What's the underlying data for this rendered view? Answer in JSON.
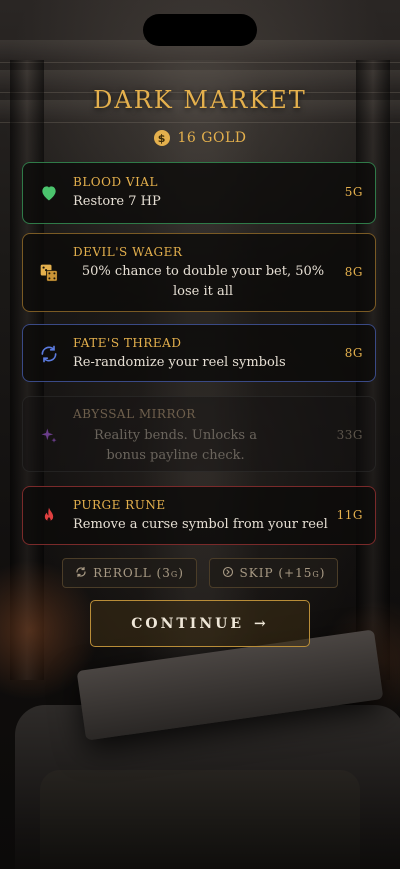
{
  "header": {
    "title": "DARK MARKET",
    "gold_text": "16 GOLD",
    "coin_symbol": "$"
  },
  "items": [
    {
      "name": "BLOOD VIAL",
      "description": "Restore 7 HP",
      "price": "5G",
      "icon": "heart-icon",
      "color": "#4bc46d"
    },
    {
      "name": "DEVIL'S WAGER",
      "description": "50% chance to double your bet, 50% lose it all",
      "price": "8G",
      "icon": "dice-icon",
      "color": "#e4b04d"
    },
    {
      "name": "FATE'S THREAD",
      "description": "Re-randomize your reel symbols",
      "price": "8G",
      "icon": "refresh-cycle-icon",
      "color": "#5b7be0"
    },
    {
      "name": "ABYSSAL MIRROR",
      "description": "Reality bends. Unlocks a bonus payline check.",
      "price": "33G",
      "icon": "sparkle-icon",
      "color": "#6a3d8a",
      "disabled": true
    },
    {
      "name": "PURGE RUNE",
      "description": "Remove a curse symbol from your reel",
      "price": "11G",
      "icon": "flame-icon",
      "color": "#e04040"
    }
  ],
  "actions": {
    "reroll_label": "REROLL (3g)",
    "skip_label": "SKIP (+15g)",
    "continue_label": "CONTINUE",
    "continue_arrow": "→"
  },
  "theme": {
    "accent": "#e4b04d",
    "background": "#0e0c0b"
  }
}
